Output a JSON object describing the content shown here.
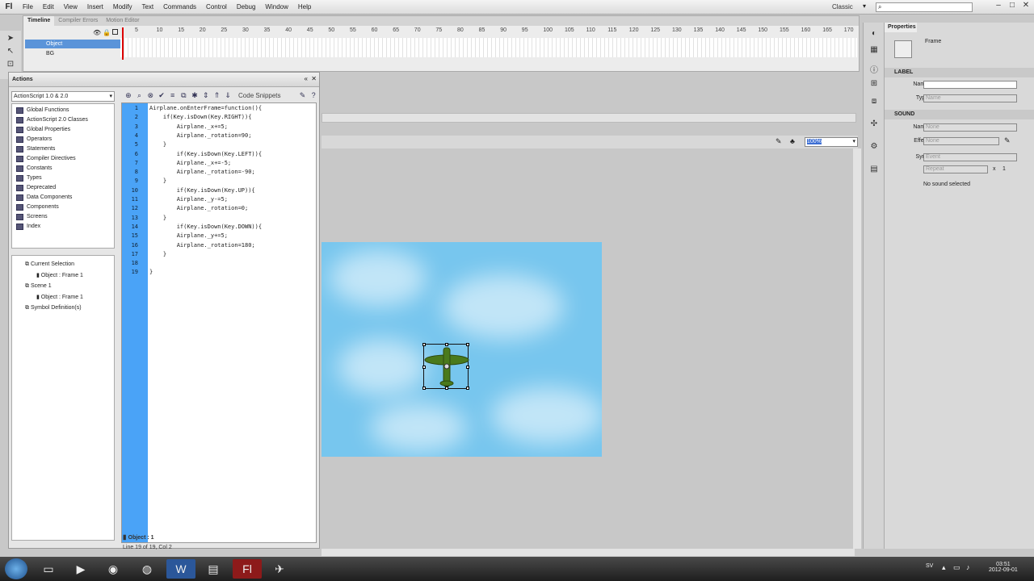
{
  "app": {
    "logo": "Fl",
    "menu": [
      "File",
      "Edit",
      "View",
      "Insert",
      "Modify",
      "Text",
      "Commands",
      "Control",
      "Debug",
      "Window",
      "Help"
    ],
    "workspace": "Classic"
  },
  "timeline": {
    "tabs": [
      "Timeline",
      "Compiler Errors",
      "Motion Editor"
    ],
    "frame_numbers": [
      "5",
      "10",
      "15",
      "20",
      "25",
      "30",
      "35",
      "40",
      "45",
      "50",
      "55",
      "60",
      "65",
      "70",
      "75",
      "80",
      "85",
      "90",
      "95",
      "100",
      "105",
      "110",
      "115",
      "120",
      "125",
      "130",
      "135",
      "140",
      "145",
      "150",
      "155",
      "160",
      "165",
      "170"
    ],
    "layers": [
      "Object",
      "BG"
    ]
  },
  "actions": {
    "title": "Actions",
    "version": "ActionScript 1.0 & 2.0",
    "code_snippets": "Code Snippets",
    "categories": [
      "Global Functions",
      "ActionScript 2.0 Classes",
      "Global Properties",
      "Operators",
      "Statements",
      "Compiler Directives",
      "Constants",
      "Types",
      "Deprecated",
      "Data Components",
      "Components",
      "Screens",
      "Index"
    ],
    "tree": [
      {
        "label": "Current Selection",
        "indent": 0
      },
      {
        "label": "Object : Frame 1",
        "indent": 1
      },
      {
        "label": "Scene 1",
        "indent": 0
      },
      {
        "label": "Object : Frame 1",
        "indent": 1
      },
      {
        "label": "Symbol Definition(s)",
        "indent": 0
      }
    ],
    "code": [
      "Airplane.onEnterFrame=function(){",
      "    if(Key.isDown(Key.RIGHT)){",
      "        Airplane._x+=5;",
      "        Airplane._rotation=90;",
      "    }",
      "        if(Key.isDown(Key.LEFT)){",
      "        Airplane._x+=-5;",
      "        Airplane._rotation=-90;",
      "    }",
      "        if(Key.isDown(Key.UP)){",
      "        Airplane._y-=5;",
      "        Airplane._rotation=0;",
      "    }",
      "        if(Key.isDown(Key.DOWN)){",
      "        Airplane._y+=5;",
      "        Airplane._rotation=180;",
      "    }",
      "",
      "}"
    ],
    "footer_tab": "Object : 1",
    "status": "Line 19 of 19, Col 2"
  },
  "stage": {
    "zoom": "100%"
  },
  "properties": {
    "tab": "Properties",
    "type": "Frame",
    "label_section": "LABEL",
    "name_label": "Name:",
    "type_label": "Type:",
    "type_value": "Name",
    "sound_section": "SOUND",
    "sound_name_value": "None",
    "effect_label": "Effect:",
    "effect_value": "None",
    "sync_label": "Sync:",
    "sync_value": "Event",
    "repeat_value": "Repeat",
    "repeat_count": "1",
    "times_sign": "x",
    "no_sound": "No sound selected"
  },
  "taskbar": {
    "lang": "SV",
    "time": "03:51",
    "date": "2012-09-01"
  }
}
